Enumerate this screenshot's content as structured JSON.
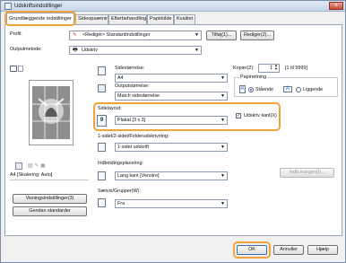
{
  "window": {
    "title": "Udskriftsindstillinger",
    "close_label": "x"
  },
  "tabs": [
    {
      "label": "Grundlæggende indstillinger"
    },
    {
      "label": "Sideopsætning"
    },
    {
      "label": "Efterbehandling"
    },
    {
      "label": "Papirkilde"
    },
    {
      "label": "Kvalitet"
    }
  ],
  "profile": {
    "label": "Profil:",
    "value": "<Redigér> Standardindstillinger",
    "add_label": "Tilføj(1)...",
    "edit_label": "Redigér(2)..."
  },
  "output_method": {
    "label": "Outputmetode:",
    "value": "Udskriv"
  },
  "preview": {
    "status_text": "A4 [Skalering: Auto]",
    "settings_button": "Visningsindstillinger(3)",
    "restore_button": "Gendan standarder"
  },
  "page_size": {
    "label": "Sidestørrelse:",
    "value": "A4"
  },
  "output_size": {
    "label": "Outputstørrelse:",
    "value": "Match sidestørrelse"
  },
  "copies": {
    "label": "Kopier(2):",
    "value": "1",
    "range": "[1 til 9999]"
  },
  "orientation": {
    "label": "Papirretning",
    "options": [
      {
        "label": "Stående",
        "selected": true
      },
      {
        "label": "Liggende",
        "selected": false
      }
    ]
  },
  "page_layout": {
    "label": "Sidelayout:",
    "value": "Plakat [3 x 3]",
    "border_checkbox_label": "Udskriv kant(X)",
    "border_checked": true
  },
  "duplex": {
    "label": "1-sidet/2-sidet/Folderudskrivning:",
    "value": "1-sidet udskrift"
  },
  "binding": {
    "label": "Indbindingsplacering:",
    "value": "Lang kant [Venstre]",
    "margin_button": "Indb.margen(I)..."
  },
  "collate": {
    "label": "Sætvis/Grupper(W):",
    "value": "Fra"
  },
  "footer": {
    "ok": "OK",
    "cancel": "Annuller",
    "help": "Hjælp"
  },
  "colors": {
    "highlight": "#f2a23a",
    "accent": "#2a66c9"
  }
}
